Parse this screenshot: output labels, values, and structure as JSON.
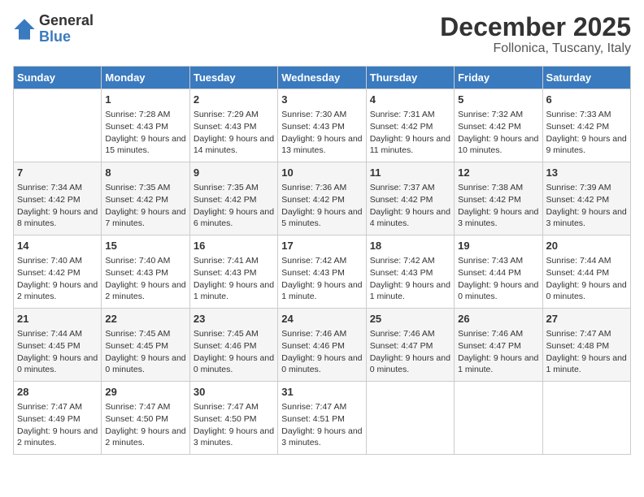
{
  "logo": {
    "text_general": "General",
    "text_blue": "Blue"
  },
  "title": {
    "month": "December 2025",
    "location": "Follonica, Tuscany, Italy"
  },
  "days_of_week": [
    "Sunday",
    "Monday",
    "Tuesday",
    "Wednesday",
    "Thursday",
    "Friday",
    "Saturday"
  ],
  "weeks": [
    [
      {
        "day": "",
        "sunrise": "",
        "sunset": "",
        "daylight": ""
      },
      {
        "day": "1",
        "sunrise": "Sunrise: 7:28 AM",
        "sunset": "Sunset: 4:43 PM",
        "daylight": "Daylight: 9 hours and 15 minutes."
      },
      {
        "day": "2",
        "sunrise": "Sunrise: 7:29 AM",
        "sunset": "Sunset: 4:43 PM",
        "daylight": "Daylight: 9 hours and 14 minutes."
      },
      {
        "day": "3",
        "sunrise": "Sunrise: 7:30 AM",
        "sunset": "Sunset: 4:43 PM",
        "daylight": "Daylight: 9 hours and 13 minutes."
      },
      {
        "day": "4",
        "sunrise": "Sunrise: 7:31 AM",
        "sunset": "Sunset: 4:42 PM",
        "daylight": "Daylight: 9 hours and 11 minutes."
      },
      {
        "day": "5",
        "sunrise": "Sunrise: 7:32 AM",
        "sunset": "Sunset: 4:42 PM",
        "daylight": "Daylight: 9 hours and 10 minutes."
      },
      {
        "day": "6",
        "sunrise": "Sunrise: 7:33 AM",
        "sunset": "Sunset: 4:42 PM",
        "daylight": "Daylight: 9 hours and 9 minutes."
      }
    ],
    [
      {
        "day": "7",
        "sunrise": "Sunrise: 7:34 AM",
        "sunset": "Sunset: 4:42 PM",
        "daylight": "Daylight: 9 hours and 8 minutes."
      },
      {
        "day": "8",
        "sunrise": "Sunrise: 7:35 AM",
        "sunset": "Sunset: 4:42 PM",
        "daylight": "Daylight: 9 hours and 7 minutes."
      },
      {
        "day": "9",
        "sunrise": "Sunrise: 7:35 AM",
        "sunset": "Sunset: 4:42 PM",
        "daylight": "Daylight: 9 hours and 6 minutes."
      },
      {
        "day": "10",
        "sunrise": "Sunrise: 7:36 AM",
        "sunset": "Sunset: 4:42 PM",
        "daylight": "Daylight: 9 hours and 5 minutes."
      },
      {
        "day": "11",
        "sunrise": "Sunrise: 7:37 AM",
        "sunset": "Sunset: 4:42 PM",
        "daylight": "Daylight: 9 hours and 4 minutes."
      },
      {
        "day": "12",
        "sunrise": "Sunrise: 7:38 AM",
        "sunset": "Sunset: 4:42 PM",
        "daylight": "Daylight: 9 hours and 3 minutes."
      },
      {
        "day": "13",
        "sunrise": "Sunrise: 7:39 AM",
        "sunset": "Sunset: 4:42 PM",
        "daylight": "Daylight: 9 hours and 3 minutes."
      }
    ],
    [
      {
        "day": "14",
        "sunrise": "Sunrise: 7:40 AM",
        "sunset": "Sunset: 4:42 PM",
        "daylight": "Daylight: 9 hours and 2 minutes."
      },
      {
        "day": "15",
        "sunrise": "Sunrise: 7:40 AM",
        "sunset": "Sunset: 4:43 PM",
        "daylight": "Daylight: 9 hours and 2 minutes."
      },
      {
        "day": "16",
        "sunrise": "Sunrise: 7:41 AM",
        "sunset": "Sunset: 4:43 PM",
        "daylight": "Daylight: 9 hours and 1 minute."
      },
      {
        "day": "17",
        "sunrise": "Sunrise: 7:42 AM",
        "sunset": "Sunset: 4:43 PM",
        "daylight": "Daylight: 9 hours and 1 minute."
      },
      {
        "day": "18",
        "sunrise": "Sunrise: 7:42 AM",
        "sunset": "Sunset: 4:43 PM",
        "daylight": "Daylight: 9 hours and 1 minute."
      },
      {
        "day": "19",
        "sunrise": "Sunrise: 7:43 AM",
        "sunset": "Sunset: 4:44 PM",
        "daylight": "Daylight: 9 hours and 0 minutes."
      },
      {
        "day": "20",
        "sunrise": "Sunrise: 7:44 AM",
        "sunset": "Sunset: 4:44 PM",
        "daylight": "Daylight: 9 hours and 0 minutes."
      }
    ],
    [
      {
        "day": "21",
        "sunrise": "Sunrise: 7:44 AM",
        "sunset": "Sunset: 4:45 PM",
        "daylight": "Daylight: 9 hours and 0 minutes."
      },
      {
        "day": "22",
        "sunrise": "Sunrise: 7:45 AM",
        "sunset": "Sunset: 4:45 PM",
        "daylight": "Daylight: 9 hours and 0 minutes."
      },
      {
        "day": "23",
        "sunrise": "Sunrise: 7:45 AM",
        "sunset": "Sunset: 4:46 PM",
        "daylight": "Daylight: 9 hours and 0 minutes."
      },
      {
        "day": "24",
        "sunrise": "Sunrise: 7:46 AM",
        "sunset": "Sunset: 4:46 PM",
        "daylight": "Daylight: 9 hours and 0 minutes."
      },
      {
        "day": "25",
        "sunrise": "Sunrise: 7:46 AM",
        "sunset": "Sunset: 4:47 PM",
        "daylight": "Daylight: 9 hours and 0 minutes."
      },
      {
        "day": "26",
        "sunrise": "Sunrise: 7:46 AM",
        "sunset": "Sunset: 4:47 PM",
        "daylight": "Daylight: 9 hours and 1 minute."
      },
      {
        "day": "27",
        "sunrise": "Sunrise: 7:47 AM",
        "sunset": "Sunset: 4:48 PM",
        "daylight": "Daylight: 9 hours and 1 minute."
      }
    ],
    [
      {
        "day": "28",
        "sunrise": "Sunrise: 7:47 AM",
        "sunset": "Sunset: 4:49 PM",
        "daylight": "Daylight: 9 hours and 2 minutes."
      },
      {
        "day": "29",
        "sunrise": "Sunrise: 7:47 AM",
        "sunset": "Sunset: 4:50 PM",
        "daylight": "Daylight: 9 hours and 2 minutes."
      },
      {
        "day": "30",
        "sunrise": "Sunrise: 7:47 AM",
        "sunset": "Sunset: 4:50 PM",
        "daylight": "Daylight: 9 hours and 3 minutes."
      },
      {
        "day": "31",
        "sunrise": "Sunrise: 7:47 AM",
        "sunset": "Sunset: 4:51 PM",
        "daylight": "Daylight: 9 hours and 3 minutes."
      },
      {
        "day": "",
        "sunrise": "",
        "sunset": "",
        "daylight": ""
      },
      {
        "day": "",
        "sunrise": "",
        "sunset": "",
        "daylight": ""
      },
      {
        "day": "",
        "sunrise": "",
        "sunset": "",
        "daylight": ""
      }
    ]
  ]
}
